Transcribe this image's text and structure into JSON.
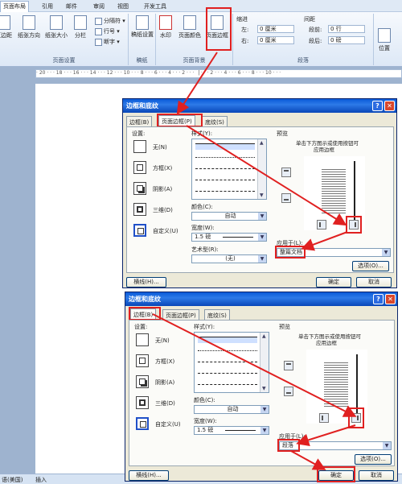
{
  "ribbon": {
    "tabs": [
      "页面布局",
      "引用",
      "邮件",
      "审阅",
      "视图",
      "开发工具"
    ],
    "page_setup": {
      "label": "页面设置",
      "btn_margins": "页边距",
      "btn_orientation": "纸张方向",
      "btn_size": "纸张大小",
      "btn_columns": "分栏",
      "btn_breaks": "分隔符",
      "btn_line_numbers": "行号",
      "btn_hyphenation": "断字"
    },
    "manuscript": {
      "label": "稿纸",
      "btn": "稿纸设置"
    },
    "page_background": {
      "label": "页面背景",
      "btn_watermark": "水印",
      "btn_page_color": "页面颜色",
      "btn_page_borders": "页面边框"
    },
    "paragraph": {
      "label": "段落",
      "indent": "缩进",
      "left": "左:",
      "left_value": "0 厘米",
      "right": "右:",
      "right_value": "0 厘米",
      "spacing": "间距",
      "before": "段前:",
      "before_value": "0 行",
      "after": "段后:",
      "after_value": "0 磅"
    },
    "arrange": {
      "btn_position": "位置"
    }
  },
  "ruler": {
    "ticks": "· 20 · · · 18 · · · 16 · · · 14 · · · 12 · · · 10 · · · 8 · · · 6 · · · 4 · · · 2 · · · ▕ · · · 2 · · · 4 · · · 6 · · · 8 · · · 10 · · ·"
  },
  "statusbar": {
    "language": "语(美国)",
    "insert": "插入"
  },
  "dialog1": {
    "title": "边框和底纹",
    "tabs": [
      "边框(B)",
      "页面边框(P)",
      "底纹(S)"
    ],
    "setting_label": "设置:",
    "settings": [
      "无(N)",
      "方框(X)",
      "阴影(A)",
      "三维(D)",
      "自定义(U)"
    ],
    "style_label": "样式(Y):",
    "color_label": "颜色(C):",
    "color_value": "自动",
    "width_label": "宽度(W):",
    "width_value": "1.5 磅",
    "art_label": "艺术型(R):",
    "art_value": "(无)",
    "preview_label": "预览",
    "preview_hint1": "单击下方图示或使用按钮可",
    "preview_hint2": "应用边框",
    "apply_label": "应用于(L):",
    "apply_value": "整篇文档",
    "options_btn": "选项(O)...",
    "hline_btn": "横线(H)...",
    "ok_btn": "确定",
    "cancel_btn": "取消"
  },
  "dialog2": {
    "title": "边框和底纹",
    "tabs": [
      "边框(B)",
      "页面边框(P)",
      "底纹(S)"
    ],
    "setting_label": "设置:",
    "settings": [
      "无(N)",
      "方框(X)",
      "阴影(A)",
      "三维(D)",
      "自定义(U)"
    ],
    "style_label": "样式(Y):",
    "color_label": "颜色(C):",
    "color_value": "自动",
    "width_label": "宽度(W):",
    "width_value": "1.5 磅",
    "preview_label": "预览",
    "preview_hint1": "单击下方图示或使用按钮可",
    "preview_hint2": "应用边框",
    "apply_label": "应用于(L):",
    "apply_value": "段落",
    "options_btn": "选项(O)...",
    "hline_btn": "横线(H)...",
    "ok_btn": "确定",
    "cancel_btn": "取消"
  },
  "colors": {
    "annotation": "#e02020",
    "titlebar": "#0a5ad8",
    "dialog_bg": "#ece9d8"
  }
}
